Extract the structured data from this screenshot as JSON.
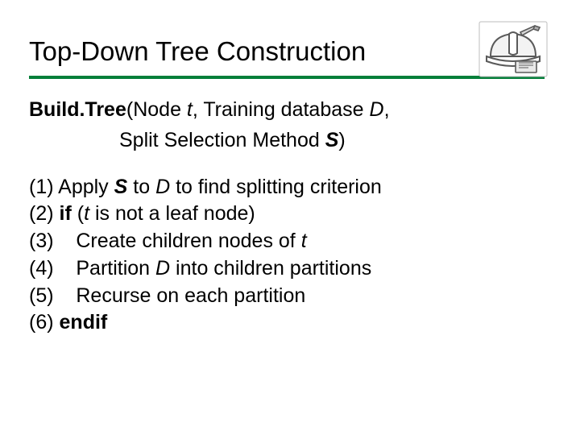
{
  "title": "Top-Down Tree Construction",
  "signature": {
    "func_name": "Build.Tree",
    "open": "(",
    "node_word": "Node",
    "t": "t",
    "comma": ",",
    "training": "Training database",
    "d": "D",
    "split": "Split Selection Method",
    "s": "S",
    "close": ")"
  },
  "steps": [
    {
      "num": "(1)",
      "a": "Apply",
      "s": "S",
      "b": "to",
      "d": "D",
      "c": "to find splitting criterion"
    },
    {
      "num": "(2)",
      "kw": "if",
      "a": "(",
      "t": "t",
      "b": "is not a leaf node)"
    },
    {
      "num": "(3)",
      "a": "Create children nodes of",
      "t": "t"
    },
    {
      "num": "(4)",
      "a": "Partition",
      "d": "D",
      "b": "into children partitions"
    },
    {
      "num": "(5)",
      "a": "Recurse on each partition"
    },
    {
      "num": "(6)",
      "kw": "endif"
    }
  ]
}
